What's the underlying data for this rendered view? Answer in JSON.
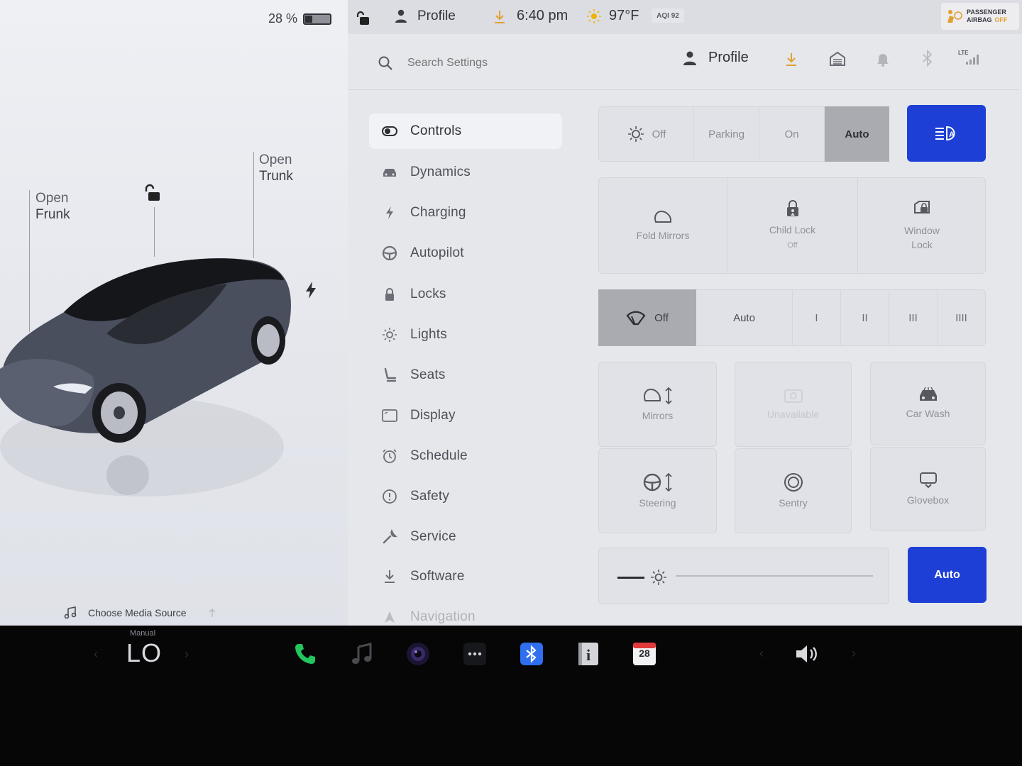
{
  "status": {
    "battery_percent": "28 %",
    "profile": "Profile",
    "time": "6:40 pm",
    "temperature": "97°F",
    "aqi": "AQI 92",
    "airbag_line1": "PASSENGER",
    "airbag_line2": "AIRBAG",
    "airbag_state": "OFF",
    "battery_level": 0.28
  },
  "car": {
    "frunk_line1": "Open",
    "frunk_line2": "Frunk",
    "trunk_line1": "Open",
    "trunk_line2": "Trunk"
  },
  "media": {
    "source_label": "Choose Media Source"
  },
  "search": {
    "placeholder": "Search Settings"
  },
  "header": {
    "profile": "Profile",
    "lte": "LTE"
  },
  "sidebar": {
    "items": [
      {
        "label": "Controls",
        "icon": "toggle-icon"
      },
      {
        "label": "Dynamics",
        "icon": "car-icon"
      },
      {
        "label": "Charging",
        "icon": "bolt-icon"
      },
      {
        "label": "Autopilot",
        "icon": "steering-wheel-icon"
      },
      {
        "label": "Locks",
        "icon": "lock-icon"
      },
      {
        "label": "Lights",
        "icon": "sun-icon"
      },
      {
        "label": "Seats",
        "icon": "seat-icon"
      },
      {
        "label": "Display",
        "icon": "display-icon"
      },
      {
        "label": "Schedule",
        "icon": "alarm-clock-icon"
      },
      {
        "label": "Safety",
        "icon": "alert-circle-icon"
      },
      {
        "label": "Service",
        "icon": "wrench-icon"
      },
      {
        "label": "Software",
        "icon": "download-icon"
      },
      {
        "label": "Navigation",
        "icon": "navigation-icon"
      }
    ]
  },
  "lights": {
    "options": [
      "Off",
      "Parking",
      "On",
      "Auto"
    ],
    "selected": "Auto"
  },
  "quick": {
    "fold_mirrors": "Fold Mirrors",
    "child_lock": "Child Lock",
    "child_lock_state": "Off",
    "window_lock_line1": "Window",
    "window_lock_line2": "Lock"
  },
  "wipers": {
    "off": "Off",
    "auto": "Auto",
    "speeds": [
      "I",
      "II",
      "III",
      "IIII"
    ],
    "selected": "Off"
  },
  "tiles": {
    "mirrors": "Mirrors",
    "unavailable": "Unavailable",
    "car_wash": "Car Wash",
    "steering": "Steering",
    "sentry": "Sentry",
    "glovebox": "Glovebox"
  },
  "brightness": {
    "auto_label": "Auto"
  },
  "dock": {
    "climate_mode": "Manual",
    "temperature": "LO",
    "calendar_day": "28"
  },
  "colors": {
    "accent_blue": "#1d3fd6",
    "phone_green": "#22c55e",
    "bluetooth_blue": "#2f6ff0",
    "calendar_red": "#e23a3a"
  }
}
